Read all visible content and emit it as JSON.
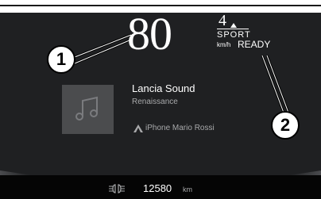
{
  "dashboard": {
    "speed": "80",
    "gear": "4",
    "drive_mode": "SPORT",
    "speed_unit": "km/h",
    "status": "READY"
  },
  "media": {
    "title": "Lancia Sound",
    "artist": "Renaissance",
    "device": "iPhone Mario Rossi",
    "album_icon": "music-note-icon",
    "device_icon": "phone-connection-icon"
  },
  "odometer": {
    "icon": "low-beam-headlight-icon",
    "value": "12580",
    "unit": "km"
  },
  "callouts": {
    "one": "1",
    "two": "2"
  },
  "colors": {
    "screen_background": "#1f2022",
    "bottom_band": "#050505",
    "text_primary": "#ffffff",
    "text_secondary": "#a8a9ab",
    "album_tile": "#4b4c4e"
  }
}
